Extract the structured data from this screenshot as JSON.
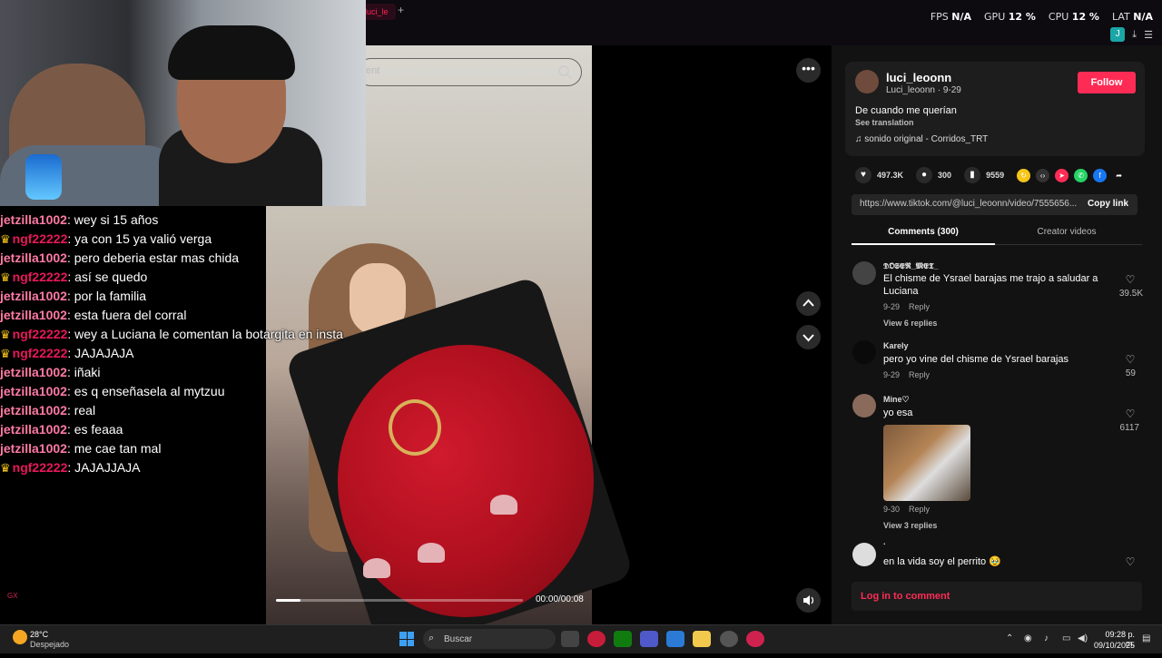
{
  "browser": {
    "tab_label": "luci_le",
    "new_tab": "+",
    "hud": [
      {
        "label": "FPS",
        "value": "N/A"
      },
      {
        "label": "GPU",
        "value": "12 %"
      },
      {
        "label": "CPU",
        "value": "12 %"
      },
      {
        "label": "LAT",
        "value": "N/A"
      }
    ],
    "profile_badge": "J"
  },
  "video": {
    "search_placeholder": "ent",
    "time": "00:00/00:08",
    "progress": 0.1
  },
  "chat": [
    {
      "user": "jetzilla1002",
      "style": "a",
      "crown": false,
      "text": ": wey si 15 años"
    },
    {
      "user": "ngf22222",
      "style": "b",
      "crown": true,
      "text": ": ya con 15 ya valió verga"
    },
    {
      "user": "jetzilla1002",
      "style": "a",
      "crown": false,
      "text": ": pero deberia estar mas chida"
    },
    {
      "user": "ngf22222",
      "style": "b",
      "crown": true,
      "text": ": así se quedo"
    },
    {
      "user": "jetzilla1002",
      "style": "a",
      "crown": false,
      "text": ": por la familia"
    },
    {
      "user": "jetzilla1002",
      "style": "a",
      "crown": false,
      "text": ": esta fuera del corral"
    },
    {
      "user": "ngf22222",
      "style": "b",
      "crown": true,
      "text": ": wey a Luciana le comentan la botargita en insta"
    },
    {
      "user": "ngf22222",
      "style": "b",
      "crown": true,
      "text": ": JAJAJAJA"
    },
    {
      "user": "jetzilla1002",
      "style": "a",
      "crown": false,
      "text": ": iñaki"
    },
    {
      "user": "jetzilla1002",
      "style": "a",
      "crown": false,
      "text": ": es q enseñasela al mytzuu"
    },
    {
      "user": "jetzilla1002",
      "style": "a",
      "crown": false,
      "text": ": real"
    },
    {
      "user": "jetzilla1002",
      "style": "a",
      "crown": false,
      "text": ": es feaaa"
    },
    {
      "user": "jetzilla1002",
      "style": "a",
      "crown": false,
      "text": ": me cae tan mal"
    },
    {
      "user": "ngf22222",
      "style": "b",
      "crown": true,
      "text": ": JAJAJJAJA"
    }
  ],
  "post": {
    "username": "luci_leoonn",
    "subline": "Luci_leoonn · 9-29",
    "follow_label": "Follow",
    "description": "De cuando me querían",
    "see_translation": "See translation",
    "music": "sonido original - Corridos_TRT",
    "likes": "497.3K",
    "comments_count": "300",
    "saves": "9559",
    "link": "https://www.tiktok.com/@luci_leoonn/video/7555656...",
    "copy_link": "Copy link",
    "tab_comments": "Comments (300)",
    "tab_creator": "Creator videos",
    "login": "Log in to comment"
  },
  "comments": [
    {
      "name": "𝕯𝕺𝕾𝕰𝕽_𝕸𝕰𝕿_",
      "text": "El chisme de Ysrael barajas me trajo a saludar a Luciana",
      "date": "9-29",
      "reply": "Reply",
      "replies": "View 6 replies",
      "likes": "39.5K"
    },
    {
      "name": "Karely",
      "text": "pero yo vine del chisme de Ysrael barajas",
      "date": "9-29",
      "reply": "Reply",
      "replies": "",
      "likes": "59"
    },
    {
      "name": "Mine♡",
      "text": "yo esa",
      "date": "9-30",
      "reply": "Reply",
      "replies": "View 3 replies",
      "likes": "6117"
    },
    {
      "name": ".",
      "text": "en la vida soy el perrito 🥹",
      "date": "",
      "reply": "",
      "replies": "",
      "likes": ""
    }
  ],
  "taskbar": {
    "temp": "28°C",
    "weather": "Despejado",
    "search": "Buscar",
    "time": "09:28 p. m.",
    "date": "09/10/2025"
  },
  "overlay": {
    "gx": "GX"
  },
  "colors": {
    "accent": "#fe2c55",
    "chat_user_a": "#ff7aa4",
    "chat_user_b": "#e8185a"
  }
}
